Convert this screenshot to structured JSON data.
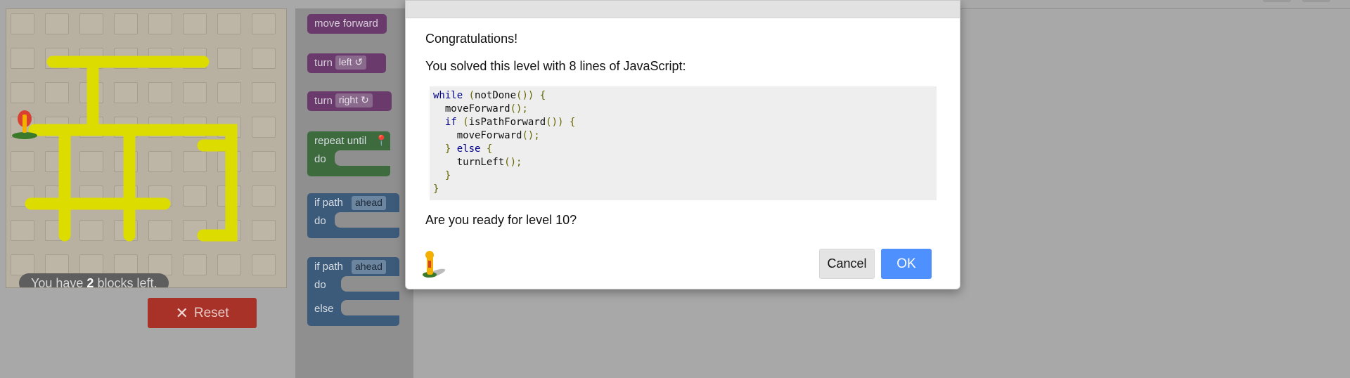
{
  "maze": {
    "blocks_left_prefix": "You have ",
    "blocks_left_count": "2",
    "blocks_left_suffix": " blocks left."
  },
  "controls": {
    "reset_label": "Reset"
  },
  "toolbox": {
    "move_forward": "move forward",
    "turn_left": {
      "label": "turn",
      "value": "left ↺"
    },
    "turn_right": {
      "label": "turn",
      "value": "right ↻"
    },
    "repeat_until": {
      "label": "repeat until",
      "do": "do"
    },
    "if_path": {
      "label": "if path",
      "value": "ahead",
      "do": "do"
    },
    "if_else": {
      "label": "if path",
      "value": "ahead",
      "do": "do",
      "else": "else"
    }
  },
  "dialog": {
    "congrats": "Congratulations!",
    "solved": "You solved this level with 8 lines of JavaScript:",
    "question": "Are you ready for level 10?",
    "cancel_label": "Cancel",
    "ok_label": "OK"
  },
  "colors": {
    "ok_button": "#4d90fe",
    "reset_button": "#a93228",
    "path": "#e2e200"
  }
}
